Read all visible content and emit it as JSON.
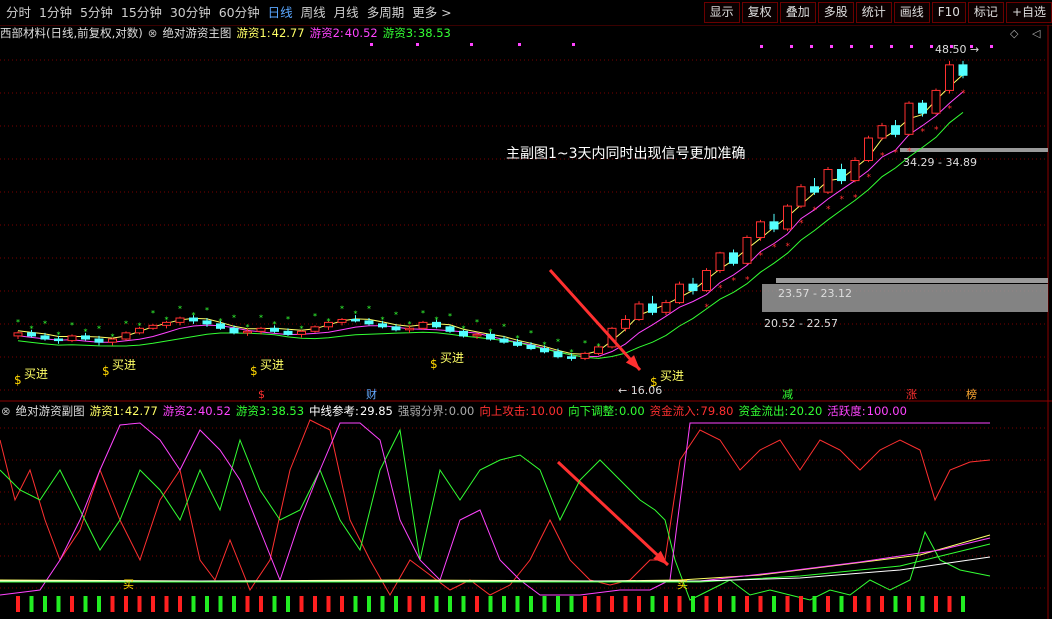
{
  "colors": {
    "up": "#ff3030",
    "down": "#54ffff",
    "ma1": "#ffff66",
    "ma2": "#ff44ff",
    "ma3": "#33ff33",
    "white": "#ffffff",
    "grid": "#7a0000",
    "gray": "#9a9a9a"
  },
  "top_tabs": [
    "分时",
    "1分钟",
    "5分钟",
    "15分钟",
    "30分钟",
    "60分钟",
    "日线",
    "周线",
    "月线",
    "多周期",
    "更多 >"
  ],
  "active_tab": "日线",
  "toolbar": [
    "显示",
    "复权",
    "叠加",
    "多股",
    "统计",
    "画线",
    "F10",
    "标记",
    "+自选"
  ],
  "main": {
    "stock_label": "西部材料(日线,前复权,对数)",
    "indicator_name": "绝对游资主图",
    "y1_label": "游资1:",
    "y1_value": "42.77",
    "y2_label": "游资2:",
    "y2_value": "40.52",
    "y3_label": "游资3:",
    "y3_value": "38.53",
    "annotation": "主副图1~3天内同时出现信号更加准确",
    "price_high": "48.50",
    "price_low": "16.06",
    "zones": [
      "34.29 - 34.89",
      "23.57 - 23.12",
      "20.52 - 22.57"
    ],
    "buy_label": "买进",
    "buy_sell_labels": [
      "买进",
      "买进",
      "买进",
      "买进",
      "买进"
    ],
    "markers": [
      "$",
      "财",
      "减",
      "涨",
      "榜"
    ],
    "controls": [
      "◇",
      "◁"
    ]
  },
  "sub": {
    "indicator_name": "绝对游资副图",
    "items": [
      {
        "label": "游资1:",
        "value": "42.77",
        "color": "#ffff66"
      },
      {
        "label": "游资2:",
        "value": "40.52",
        "color": "#ff44ff"
      },
      {
        "label": "游资3:",
        "value": "38.53",
        "color": "#33ff33"
      },
      {
        "label": "中线参考:",
        "value": "29.85",
        "color": "#ffffff"
      },
      {
        "label": "强弱分界:",
        "value": "0.00",
        "color": "#aaaaaa"
      },
      {
        "label": "向上攻击:",
        "value": "10.00",
        "color": "#ff3030"
      },
      {
        "label": "向下调整:",
        "value": "0.00",
        "color": "#33ff33"
      },
      {
        "label": "资金流入:",
        "value": "79.80",
        "color": "#ff3030"
      },
      {
        "label": "资金流出:",
        "value": "20.20",
        "color": "#33ff33"
      },
      {
        "label": "活跃度:",
        "value": "100.00",
        "color": "#ff44ff"
      }
    ],
    "buy_char": "买"
  },
  "chart_data": {
    "type": "candlestick",
    "scale": "log",
    "ylim": [
      14,
      52
    ],
    "candles": [
      [
        17.6,
        17.9,
        17.4,
        17.8
      ],
      [
        17.8,
        18.0,
        17.5,
        17.6
      ],
      [
        17.6,
        17.8,
        17.3,
        17.4
      ],
      [
        17.4,
        17.6,
        17.1,
        17.3
      ],
      [
        17.3,
        17.7,
        17.2,
        17.6
      ],
      [
        17.6,
        17.8,
        17.3,
        17.4
      ],
      [
        17.4,
        17.6,
        17.0,
        17.2
      ],
      [
        17.2,
        17.5,
        17.0,
        17.4
      ],
      [
        17.4,
        17.9,
        17.3,
        17.8
      ],
      [
        17.8,
        18.2,
        17.7,
        18.1
      ],
      [
        18.1,
        18.4,
        18.0,
        18.3
      ],
      [
        18.3,
        18.6,
        18.1,
        18.5
      ],
      [
        18.5,
        18.9,
        18.3,
        18.8
      ],
      [
        18.8,
        19.0,
        18.4,
        18.6
      ],
      [
        18.6,
        18.8,
        18.2,
        18.4
      ],
      [
        18.4,
        18.6,
        18.0,
        18.1
      ],
      [
        18.1,
        18.3,
        17.7,
        17.8
      ],
      [
        17.8,
        18.1,
        17.6,
        17.9
      ],
      [
        17.9,
        18.2,
        17.7,
        18.1
      ],
      [
        18.1,
        18.3,
        17.8,
        17.9
      ],
      [
        17.9,
        18.1,
        17.6,
        17.7
      ],
      [
        17.7,
        18.0,
        17.5,
        17.9
      ],
      [
        17.9,
        18.3,
        17.8,
        18.2
      ],
      [
        18.2,
        18.6,
        18.0,
        18.5
      ],
      [
        18.5,
        18.8,
        18.3,
        18.7
      ],
      [
        18.7,
        19.0,
        18.5,
        18.6
      ],
      [
        18.6,
        18.8,
        18.3,
        18.4
      ],
      [
        18.4,
        18.6,
        18.1,
        18.2
      ],
      [
        18.2,
        18.4,
        17.9,
        18.0
      ],
      [
        18.0,
        18.3,
        17.8,
        18.1
      ],
      [
        18.1,
        18.6,
        18.0,
        18.5
      ],
      [
        18.5,
        18.7,
        18.1,
        18.2
      ],
      [
        18.2,
        18.3,
        17.8,
        17.9
      ],
      [
        17.9,
        18.0,
        17.5,
        17.6
      ],
      [
        17.6,
        17.8,
        17.4,
        17.7
      ],
      [
        17.7,
        17.9,
        17.3,
        17.4
      ],
      [
        17.4,
        17.6,
        17.1,
        17.2
      ],
      [
        17.2,
        17.4,
        16.9,
        17.0
      ],
      [
        17.0,
        17.2,
        16.7,
        16.8
      ],
      [
        16.8,
        17.0,
        16.5,
        16.6
      ],
      [
        16.6,
        16.8,
        16.2,
        16.3
      ],
      [
        16.3,
        16.5,
        16.06,
        16.2
      ],
      [
        16.2,
        16.6,
        16.1,
        16.5
      ],
      [
        16.5,
        17.0,
        16.4,
        16.9
      ],
      [
        16.9,
        18.2,
        16.8,
        18.1
      ],
      [
        18.1,
        19.0,
        17.9,
        18.7
      ],
      [
        18.7,
        20.0,
        18.6,
        19.8
      ],
      [
        19.8,
        20.4,
        19.0,
        19.2
      ],
      [
        19.2,
        20.1,
        19.0,
        19.9
      ],
      [
        19.9,
        21.5,
        19.8,
        21.3
      ],
      [
        21.3,
        21.8,
        20.5,
        20.8
      ],
      [
        20.8,
        22.6,
        20.7,
        22.4
      ],
      [
        22.4,
        24.0,
        22.2,
        23.9
      ],
      [
        23.9,
        24.2,
        22.8,
        23.0
      ],
      [
        23.0,
        25.5,
        22.9,
        25.3
      ],
      [
        25.3,
        27.0,
        25.0,
        26.8
      ],
      [
        26.8,
        27.6,
        25.8,
        26.1
      ],
      [
        26.1,
        28.6,
        25.9,
        28.4
      ],
      [
        28.4,
        30.8,
        28.2,
        30.5
      ],
      [
        30.5,
        31.5,
        29.6,
        29.9
      ],
      [
        29.9,
        32.8,
        29.7,
        32.5
      ],
      [
        32.5,
        33.2,
        30.8,
        31.2
      ],
      [
        31.2,
        34.0,
        31.0,
        33.6
      ],
      [
        33.6,
        36.8,
        33.4,
        36.5
      ],
      [
        36.5,
        38.6,
        36.2,
        38.2
      ],
      [
        38.2,
        39.0,
        36.6,
        37.0
      ],
      [
        37.0,
        41.8,
        36.8,
        41.5
      ],
      [
        41.5,
        42.0,
        39.5,
        40.0
      ],
      [
        40.0,
        43.8,
        39.8,
        43.5
      ],
      [
        43.5,
        48.5,
        43.0,
        47.8
      ],
      [
        47.8,
        48.5,
        45.5,
        46.0
      ]
    ],
    "series": [
      {
        "name": "游资1",
        "value": 42.77
      },
      {
        "name": "游资2",
        "value": 40.52
      },
      {
        "name": "游资3",
        "value": 38.53
      }
    ]
  }
}
